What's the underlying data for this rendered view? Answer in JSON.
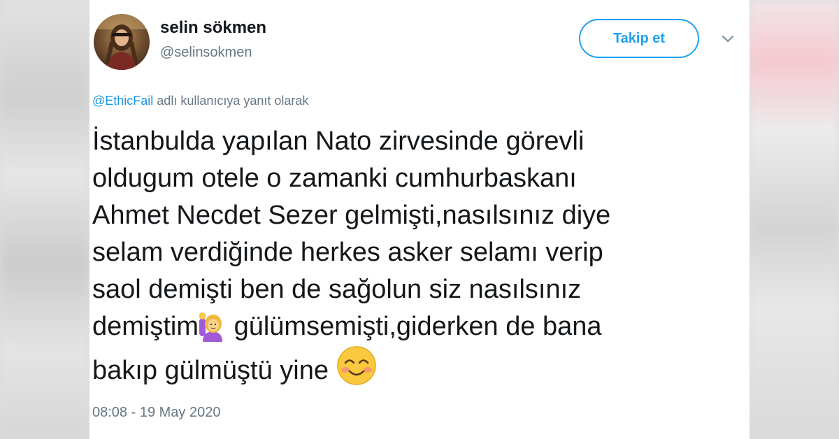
{
  "user": {
    "name": "selin sökmen",
    "handle": "@selinsokmen"
  },
  "follow_button": {
    "label": "Takip et"
  },
  "reply_context": {
    "mention": "@EthicFail",
    "suffix": " adlı kullanıcıya yanıt olarak"
  },
  "tweet": {
    "lines": [
      "İstanbulda yapılan Nato zirvesinde görevli",
      "oldugum otele o zamanki cumhurbaskanı",
      "Ahmet Necdet Sezer gelmişti,nasılsınız diye",
      "selam verdiğinde herkes asker selamı verip",
      "saol demişti ben de sağolun siz nasılsınız"
    ],
    "line6_before_emoji": "demiştim",
    "line6_after_emoji": " gülümsemişti,giderken de bana",
    "line7": "bakıp gülmüştü yine ",
    "emojis": [
      "woman-raising-hand-emoji",
      "smiling-face-with-smiling-eyes-emoji"
    ]
  },
  "timestamp": "08:08 - 19 May 2020",
  "colors": {
    "accent": "#1da1f2",
    "mention": "#1b95e0",
    "secondary_text": "#657786",
    "primary_text": "#14171a"
  },
  "icons": [
    "avatar-photo",
    "chevron-down-icon"
  ]
}
